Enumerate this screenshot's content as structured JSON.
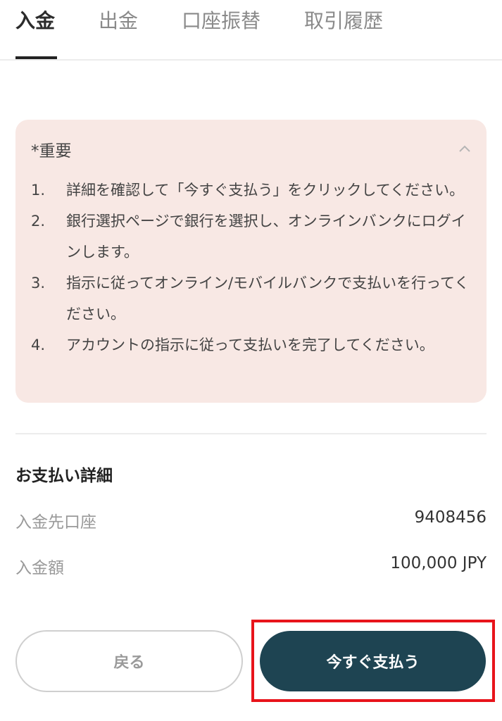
{
  "tabs": [
    {
      "label": "入金",
      "active": true
    },
    {
      "label": "出金",
      "active": false
    },
    {
      "label": "口座振替",
      "active": false
    },
    {
      "label": "取引履歴",
      "active": false
    }
  ],
  "notice": {
    "title": "*重要",
    "steps": [
      {
        "num": "1.",
        "text": "詳細を確認して「今すぐ支払う」をクリックしてください。"
      },
      {
        "num": "2.",
        "text": "銀行選択ページで銀行を選択し、オンラインバンクにログインします。"
      },
      {
        "num": "3.",
        "text": "指示に従ってオンライン/モバイルバンクで支払いを行ってください。"
      },
      {
        "num": "4.",
        "text": "アカウントの指示に従って支払いを完了してください。"
      }
    ]
  },
  "payment_details": {
    "title": "お支払い詳細",
    "account_label": "入金先口座",
    "account_value": "9408456",
    "amount_label": "入金額",
    "amount_value": "100,000 JPY"
  },
  "buttons": {
    "back_label": "戻る",
    "pay_label": "今すぐ支払う"
  },
  "colors": {
    "notice_bg": "#f8e8e4",
    "primary": "#1e4452",
    "highlight": "#e8141b"
  }
}
